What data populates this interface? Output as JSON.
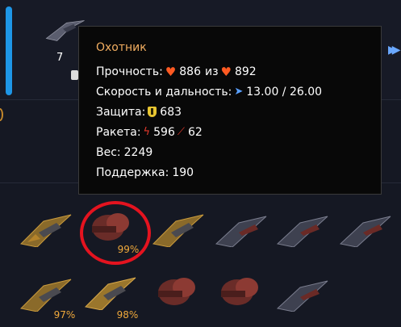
{
  "top_panel": {
    "ship_count": "7"
  },
  "tooltip": {
    "title": "Охотник",
    "durability_label": "Прочность:",
    "durability_current": "886",
    "durability_of": "из",
    "durability_max": "892",
    "speed_label": "Скорость и дальность:",
    "speed_value": "13.00 / 26.00",
    "defense_label": "Защита:",
    "defense_value": "683",
    "missile_label": "Ракета:",
    "missile_damage": "596",
    "missile_second": "62",
    "weight_label": "Вес:",
    "weight_value": "2249",
    "support_label": "Поддержка:",
    "support_value": "190"
  },
  "fleet": {
    "row1": [
      {
        "type": "hunter-gold",
        "percent": ""
      },
      {
        "type": "heavy-red",
        "percent": "99%"
      },
      {
        "type": "hunter-gold",
        "percent": ""
      },
      {
        "type": "fighter-navy",
        "percent": ""
      },
      {
        "type": "fighter-navy",
        "percent": ""
      },
      {
        "type": "fighter-navy",
        "percent": ""
      }
    ],
    "row2": [
      {
        "type": "hunter-gold",
        "percent": "97%"
      },
      {
        "type": "hunter-gold",
        "percent": "98%"
      },
      {
        "type": "heavy-red",
        "percent": ""
      },
      {
        "type": "heavy-red",
        "percent": ""
      },
      {
        "type": "fighter-navy",
        "percent": ""
      }
    ]
  },
  "colors": {
    "accent": "#1e96e6",
    "percent_text": "#f0a93b",
    "tooltip_title": "#f1ad60",
    "highlight_ring": "#e4131f"
  }
}
